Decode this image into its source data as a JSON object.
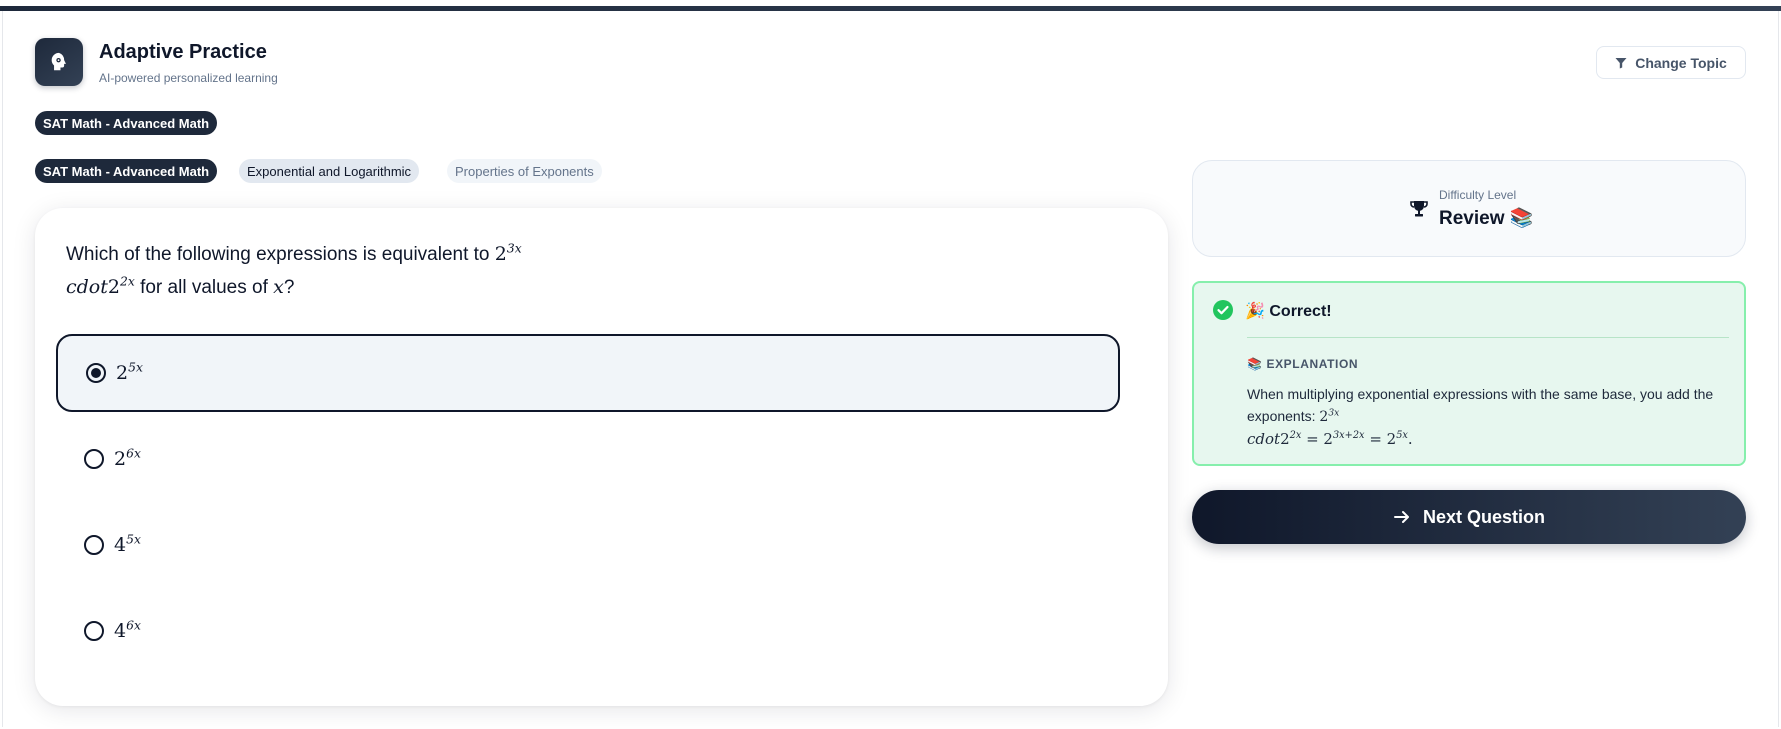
{
  "header": {
    "title": "Adaptive Practice",
    "subtitle": "AI-powered personalized learning",
    "change_topic_label": "Change Topic",
    "topic_badge": "SAT Math - Advanced Math"
  },
  "breadcrumb": {
    "items": [
      "SAT Math - Advanced Math",
      "Exponential and Logarithmic",
      "Properties of Exponents"
    ]
  },
  "question": {
    "prefix": "Which of the following expressions is equivalent to ",
    "line1_base": "2",
    "line1_exp": "3x",
    "line2_cdot": "cdot",
    "line2_base": "2",
    "line2_exp": "2x",
    "line2_mid": " for all values of ",
    "line2_var": "x",
    "line2_end": "?"
  },
  "options": [
    {
      "base": "2",
      "exp": "5x",
      "selected": true
    },
    {
      "base": "2",
      "exp": "6x",
      "selected": false
    },
    {
      "base": "4",
      "exp": "5x",
      "selected": false
    },
    {
      "base": "4",
      "exp": "6x",
      "selected": false
    }
  ],
  "difficulty": {
    "label": "Difficulty Level",
    "value": "Review 📚"
  },
  "feedback": {
    "title": "🎉 Correct!",
    "explanation_heading": "📚 EXPLANATION",
    "explanation_text": "When multiplying exponential expressions with the same base, you add the exponents: ",
    "e_base1": "2",
    "e_exp1": "3x",
    "e_cdot": "cdot",
    "e_base2": "2",
    "e_exp2": "2x",
    "e_eq1": " = ",
    "e_base3": "2",
    "e_exp3": "3x+2x",
    "e_eq2": " = ",
    "e_base4": "2",
    "e_exp4": "5x",
    "e_end": "."
  },
  "next_button_label": "Next Question",
  "colors": {
    "primary": "#0f172a",
    "success_bg": "#e7f7ef",
    "success_border": "#86efac",
    "success_icon": "#22c55e"
  }
}
